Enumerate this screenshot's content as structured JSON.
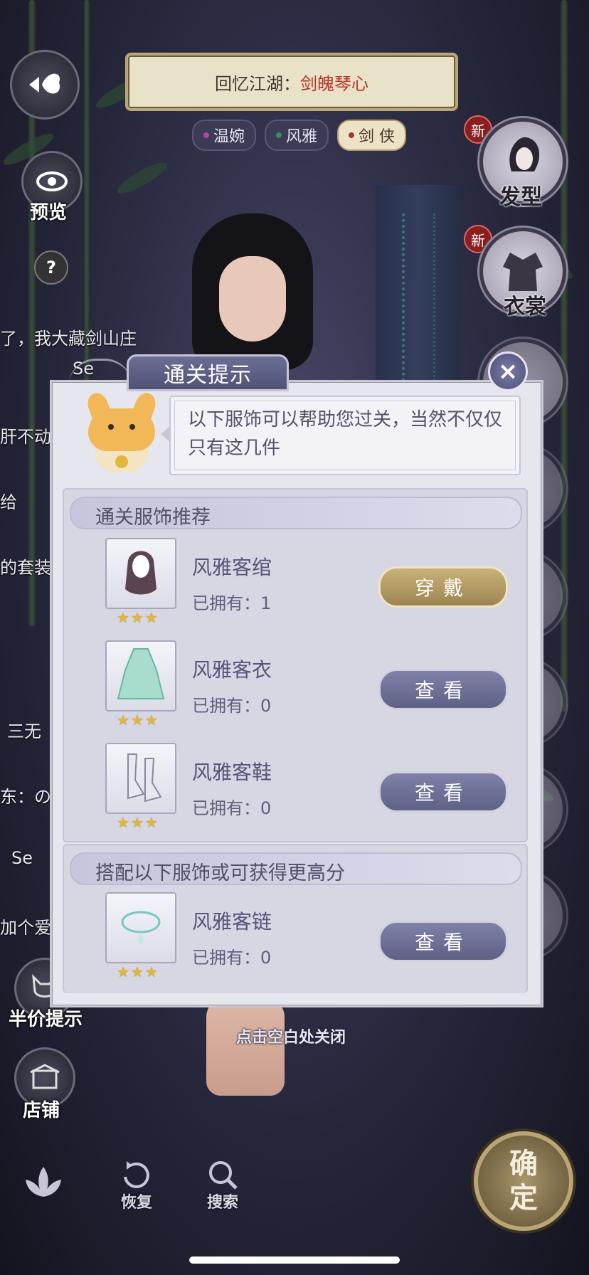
{
  "top_bar": {
    "title_prefix": "回忆江湖：",
    "title_highlight": "剑魄琴心"
  },
  "tags": [
    {
      "label": "温婉"
    },
    {
      "label": "风雅"
    },
    {
      "label": "剑 侠"
    }
  ],
  "left_menu": {
    "preview_label": "预览",
    "help_label": "?",
    "hint_label": "半价提示",
    "shop_label": "店铺"
  },
  "right_menu": {
    "hairstyle_label": "发型",
    "clothes_label": "衣裳",
    "new_badge": "新"
  },
  "chat_lines": [
    "了，我大藏剑山庄",
    "Se",
    "肝不动",
    "给",
    "的套装",
    "三无",
    "东：の",
    "Se",
    "加个爱"
  ],
  "dialog": {
    "tab_title": "通关提示",
    "close_icon": "×",
    "speech_text": "以下服饰可以帮助您过关，当然不仅仅只有这几件",
    "section1": {
      "title": "通关服饰推荐",
      "items": [
        {
          "name": "风雅客绾",
          "owned": "已拥有：1",
          "button": "穿戴",
          "button_style": "wear",
          "stars": "★★★"
        },
        {
          "name": "风雅客衣",
          "owned": "已拥有：0",
          "button": "查看",
          "button_style": "view",
          "stars": "★★★"
        },
        {
          "name": "风雅客鞋",
          "owned": "已拥有：0",
          "button": "查看",
          "button_style": "view",
          "stars": "★★★"
        }
      ]
    },
    "section2": {
      "title": "搭配以下服饰或可获得更高分",
      "items": [
        {
          "name": "风雅客链",
          "owned": "已拥有：0",
          "button": "查看",
          "button_style": "view",
          "stars": "★★★"
        }
      ]
    }
  },
  "hint": "点击空白处关闭",
  "bottom_bar": {
    "restore_label": "恢复",
    "search_label": "搜索",
    "confirm_label_1": "确",
    "confirm_label_2": "定"
  }
}
